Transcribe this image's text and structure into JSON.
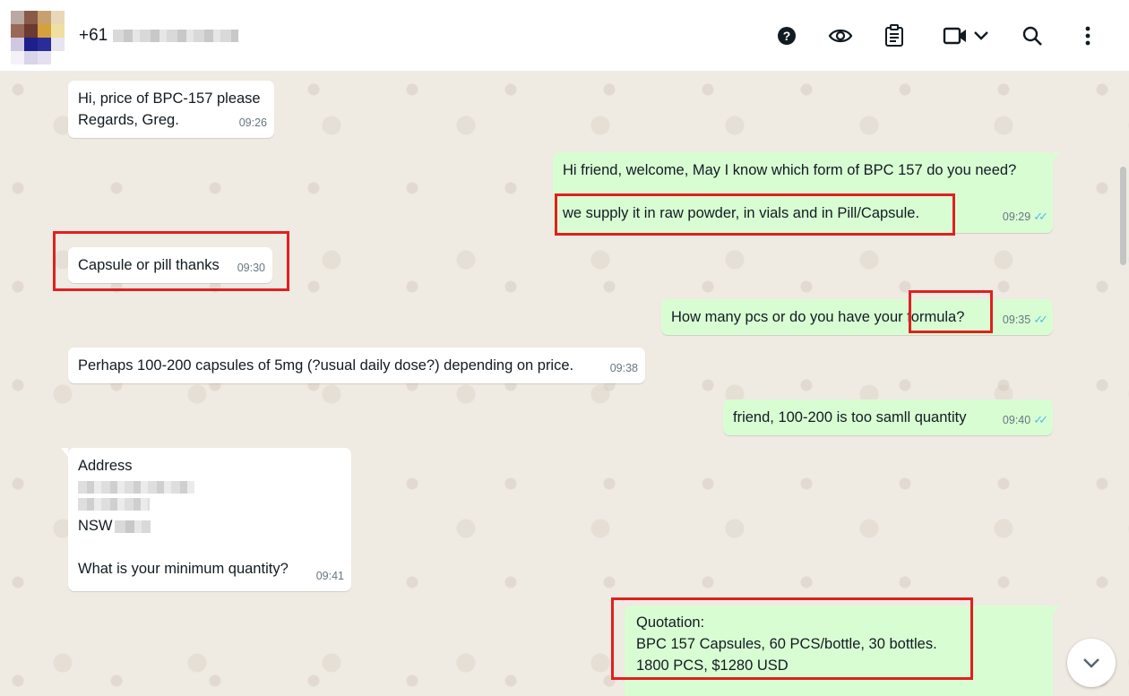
{
  "header": {
    "contact_name": "+61",
    "icons": [
      "help-icon",
      "view-once-icon",
      "clipboard-icon",
      "video-call-icon",
      "chevron-down-icon",
      "search-icon",
      "menu-icon"
    ]
  },
  "colors": {
    "incoming_bubble": "#ffffff",
    "outgoing_bubble": "#d9fdd3",
    "highlight": "#e02020",
    "read_ticks": "#53bdeb"
  },
  "messages": [
    {
      "direction": "in",
      "lines": [
        "Hi, price of BPC-157 please",
        "Regards, Greg."
      ],
      "time": "09:26"
    },
    {
      "direction": "out",
      "lines": [
        "Hi friend, welcome, May I know which form of BPC 157 do you need?",
        "we supply it in raw powder, in vials and in Pill/Capsule."
      ],
      "time": "09:29",
      "ticks": "✓✓"
    },
    {
      "direction": "in",
      "lines": [
        "Capsule or pill thanks"
      ],
      "time": "09:30"
    },
    {
      "direction": "out",
      "lines": [
        "How many pcs or do you have your formula?"
      ],
      "time": "09:35",
      "ticks": "✓✓"
    },
    {
      "direction": "in",
      "lines": [
        "Perhaps 100-200 capsules of 5mg (?usual daily dose?) depending on price."
      ],
      "time": "09:38"
    },
    {
      "direction": "out",
      "lines": [
        "friend, 100-200 is too samll quantity"
      ],
      "time": "09:40",
      "ticks": "✓✓"
    },
    {
      "direction": "in",
      "lines": [
        "Address",
        "NSW",
        "What is your minimum quantity?"
      ],
      "time": "09:41"
    },
    {
      "direction": "out",
      "lines": [
        "Quotation:",
        "BPC 157 Capsules, 60 PCS/bottle, 30 bottles.",
        "1800 PCS, $1280 USD"
      ]
    }
  ]
}
